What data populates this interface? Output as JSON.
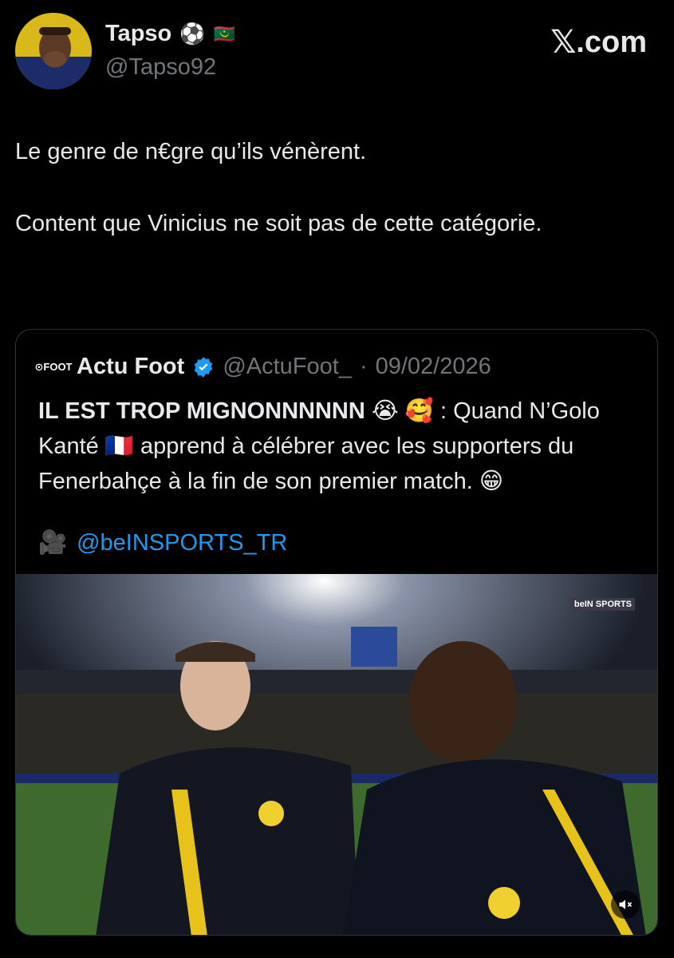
{
  "author": {
    "name": "Tapso",
    "badges": [
      "⚽",
      "🇲🇷"
    ],
    "handle": "@Tapso92"
  },
  "brand": {
    "x_glyph": "𝕏",
    "suffix": ".com"
  },
  "tweet": {
    "text": "Le genre de n€gre qu’ils vénèrent.\n\nContent que Vinicius ne soit pas de cette catégorie."
  },
  "quoted": {
    "logo_text": "⊙FOOT",
    "name": "Actu Foot",
    "handle": "@ActuFoot_",
    "separator": "·",
    "date": "09/02/2026",
    "headline": "IL EST TROP MIGNONNNNNN",
    "headline_emojis": "😭 🥰",
    "body_1": ": Quand N’Golo Kanté",
    "flag": "🇫🇷",
    "body_2": "apprend à célébrer avec les supporters du Fenerbahçe à la fin de son premier match.",
    "end_emoji": "😁",
    "credit_icon": "🎥",
    "credit_link": "@beINSPORTS_TR",
    "media": {
      "broadcaster_label": "beIN SPORTS",
      "mute_icon": "speaker-muted-icon"
    }
  },
  "colors": {
    "background": "#000000",
    "text": "#e7e9ea",
    "muted": "#71767b",
    "link": "#1d9bf0",
    "verified": "#1d9bf0",
    "border": "#2f3336"
  }
}
